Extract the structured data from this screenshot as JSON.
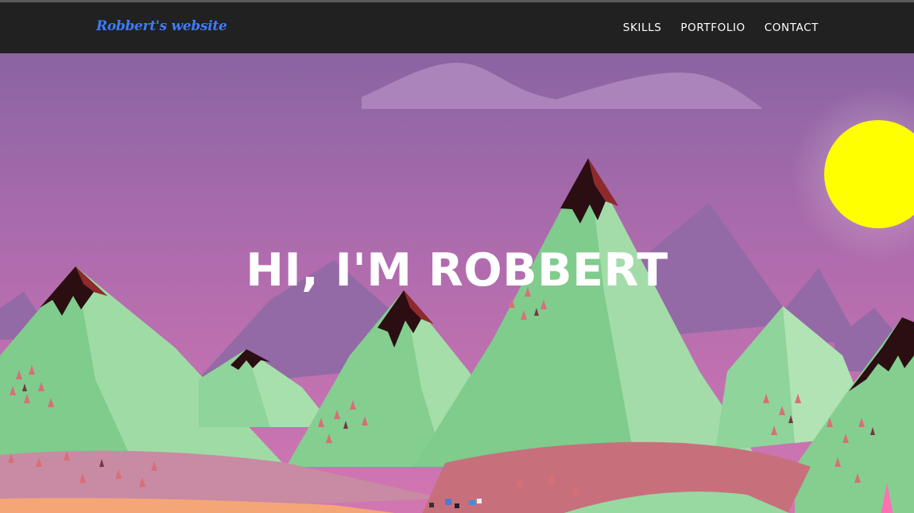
{
  "navbar": {
    "brand": "Robbert's website",
    "links": [
      {
        "label": "SKILLS"
      },
      {
        "label": "PORTFOLIO"
      },
      {
        "label": "CONTACT"
      }
    ]
  },
  "hero": {
    "title": "HI, I'M ROBBERT"
  },
  "colors": {
    "navbar_bg": "#212121",
    "brand_color": "#3d7bff",
    "sky_top": "#8a64a2",
    "sky_bottom": "#d376b2",
    "sun": "#ffff00",
    "mountain_green": "#84cf8f",
    "peak_dark": "#2a0e12"
  }
}
